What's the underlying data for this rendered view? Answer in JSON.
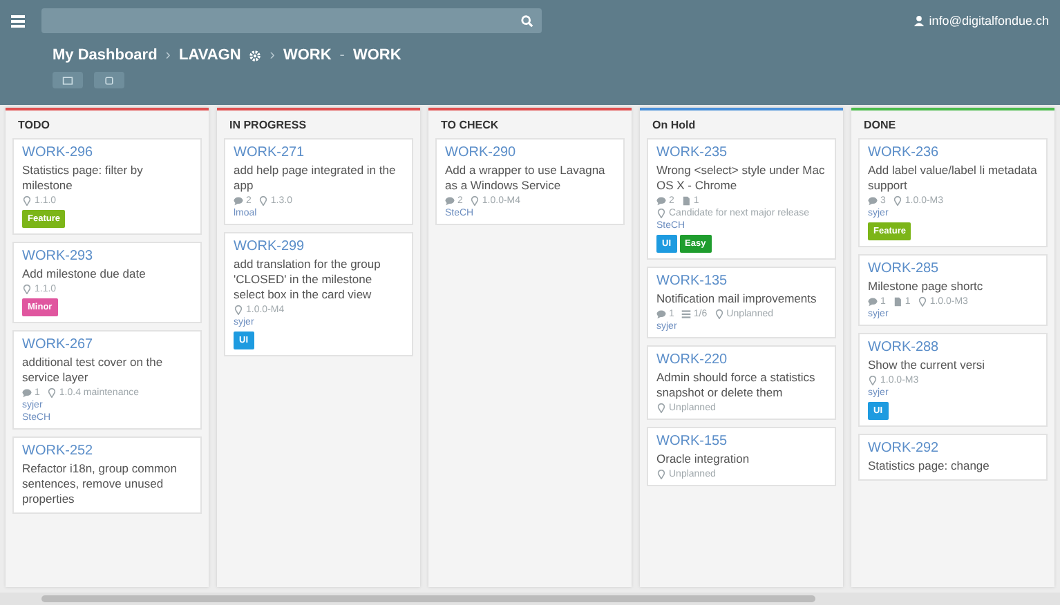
{
  "topbar": {
    "user": "info@digitalfondue.ch"
  },
  "breadcrumb": [
    {
      "kind": "link",
      "text": "My Dashboard"
    },
    {
      "kind": "separator",
      "text": "›"
    },
    {
      "kind": "project",
      "text": "LAVAGN"
    },
    {
      "kind": "separator",
      "text": "›"
    },
    {
      "kind": "link",
      "text": "WORK"
    },
    {
      "kind": "separator",
      "text": "-"
    },
    {
      "kind": "link",
      "text": "WORK"
    }
  ],
  "columns": [
    {
      "title": "TODO",
      "color": "#e05050",
      "cards": [
        {
          "id": "WORK-296",
          "title": "Statistics page: filter by milestone",
          "meta_lines": [
            [
              {
                "kind": "milestone",
                "text": "1.1.0"
              }
            ]
          ],
          "labels": [
            {
              "text": "Feature",
              "color": "#7cb518"
            }
          ]
        },
        {
          "id": "WORK-293",
          "title": "Add milestone due date",
          "meta_lines": [
            [
              {
                "kind": "milestone",
                "text": "1.1.0"
              }
            ]
          ],
          "labels": [
            {
              "text": "Minor",
              "color": "#e0569f"
            }
          ]
        },
        {
          "id": "WORK-267",
          "title": "additional test cover on the service layer",
          "meta_lines": [
            [
              {
                "kind": "comments",
                "text": "1"
              },
              {
                "kind": "milestone",
                "text": "1.0.4 maintenance"
              }
            ]
          ],
          "users": [
            "syjer",
            "SteCH"
          ]
        },
        {
          "id": "WORK-252",
          "title": "Refactor i18n, group common sentences, remove unused properties"
        }
      ]
    },
    {
      "title": "IN PROGRESS",
      "color": "#e05050",
      "cards": [
        {
          "id": "WORK-271",
          "title": "add help page integrated in the app",
          "meta_lines": [
            [
              {
                "kind": "comments",
                "text": "2"
              },
              {
                "kind": "milestone",
                "text": "1.3.0"
              }
            ]
          ],
          "users": [
            "lmoal"
          ]
        },
        {
          "id": "WORK-299",
          "title": "add translation for the group 'CLOSED' in the milestone select box in the card view",
          "meta_lines": [
            [
              {
                "kind": "milestone",
                "text": "1.0.0-M4"
              }
            ]
          ],
          "users": [
            "syjer"
          ],
          "labels": [
            {
              "text": "UI",
              "color": "#1e9be0"
            }
          ]
        }
      ]
    },
    {
      "title": "TO CHECK",
      "color": "#e05050",
      "cards": [
        {
          "id": "WORK-290",
          "title": "Add a wrapper to use Lavagna as a Windows Service",
          "meta_lines": [
            [
              {
                "kind": "comments",
                "text": "2"
              },
              {
                "kind": "milestone",
                "text": "1.0.0-M4"
              }
            ]
          ],
          "users": [
            "SteCH"
          ]
        }
      ]
    },
    {
      "title": "On Hold",
      "color": "#4a90d9",
      "cards": [
        {
          "id": "WORK-235",
          "title": "Wrong <select> style under Mac OS X - Chrome",
          "meta_lines": [
            [
              {
                "kind": "comments",
                "text": "2"
              },
              {
                "kind": "files",
                "text": "1"
              }
            ],
            [
              {
                "kind": "milestone",
                "text": "Candidate for next major release"
              }
            ]
          ],
          "users": [
            "SteCH"
          ],
          "labels": [
            {
              "text": "UI",
              "color": "#1e9be0"
            },
            {
              "text": "Easy",
              "color": "#1f9d2e"
            }
          ]
        },
        {
          "id": "WORK-135",
          "title": "Notification mail improvements",
          "meta_lines": [
            [
              {
                "kind": "comments",
                "text": "1"
              },
              {
                "kind": "tasks",
                "text": "1/6"
              },
              {
                "kind": "milestone",
                "text": "Unplanned"
              }
            ]
          ],
          "users": [
            "syjer"
          ]
        },
        {
          "id": "WORK-220",
          "title": "Admin should force a statistics snapshot or delete them",
          "meta_lines": [
            [
              {
                "kind": "milestone",
                "text": "Unplanned"
              }
            ]
          ]
        },
        {
          "id": "WORK-155",
          "title": "Oracle integration",
          "meta_lines": [
            [
              {
                "kind": "milestone",
                "text": "Unplanned"
              }
            ]
          ]
        }
      ]
    },
    {
      "title": "DONE",
      "color": "#4cbb4c",
      "cards": [
        {
          "id": "WORK-236",
          "title": "Add label value/label li metadata support",
          "meta_lines": [
            [
              {
                "kind": "comments",
                "text": "3"
              },
              {
                "kind": "milestone",
                "text": "1.0.0-M3"
              }
            ]
          ],
          "users": [
            "syjer"
          ],
          "labels": [
            {
              "text": "Feature",
              "color": "#7cb518"
            }
          ]
        },
        {
          "id": "WORK-285",
          "title": "Milestone page shortc",
          "meta_lines": [
            [
              {
                "kind": "comments",
                "text": "1"
              },
              {
                "kind": "files",
                "text": "1"
              },
              {
                "kind": "milestone",
                "text": "1.0.0-M3"
              }
            ]
          ],
          "users": [
            "syjer"
          ]
        },
        {
          "id": "WORK-288",
          "title": "Show the current versi",
          "meta_lines": [
            [
              {
                "kind": "milestone",
                "text": "1.0.0-M3"
              }
            ]
          ],
          "users": [
            "syjer"
          ],
          "labels": [
            {
              "text": "UI",
              "color": "#1e9be0"
            }
          ]
        },
        {
          "id": "WORK-292",
          "title": "Statistics page: change"
        }
      ]
    }
  ]
}
